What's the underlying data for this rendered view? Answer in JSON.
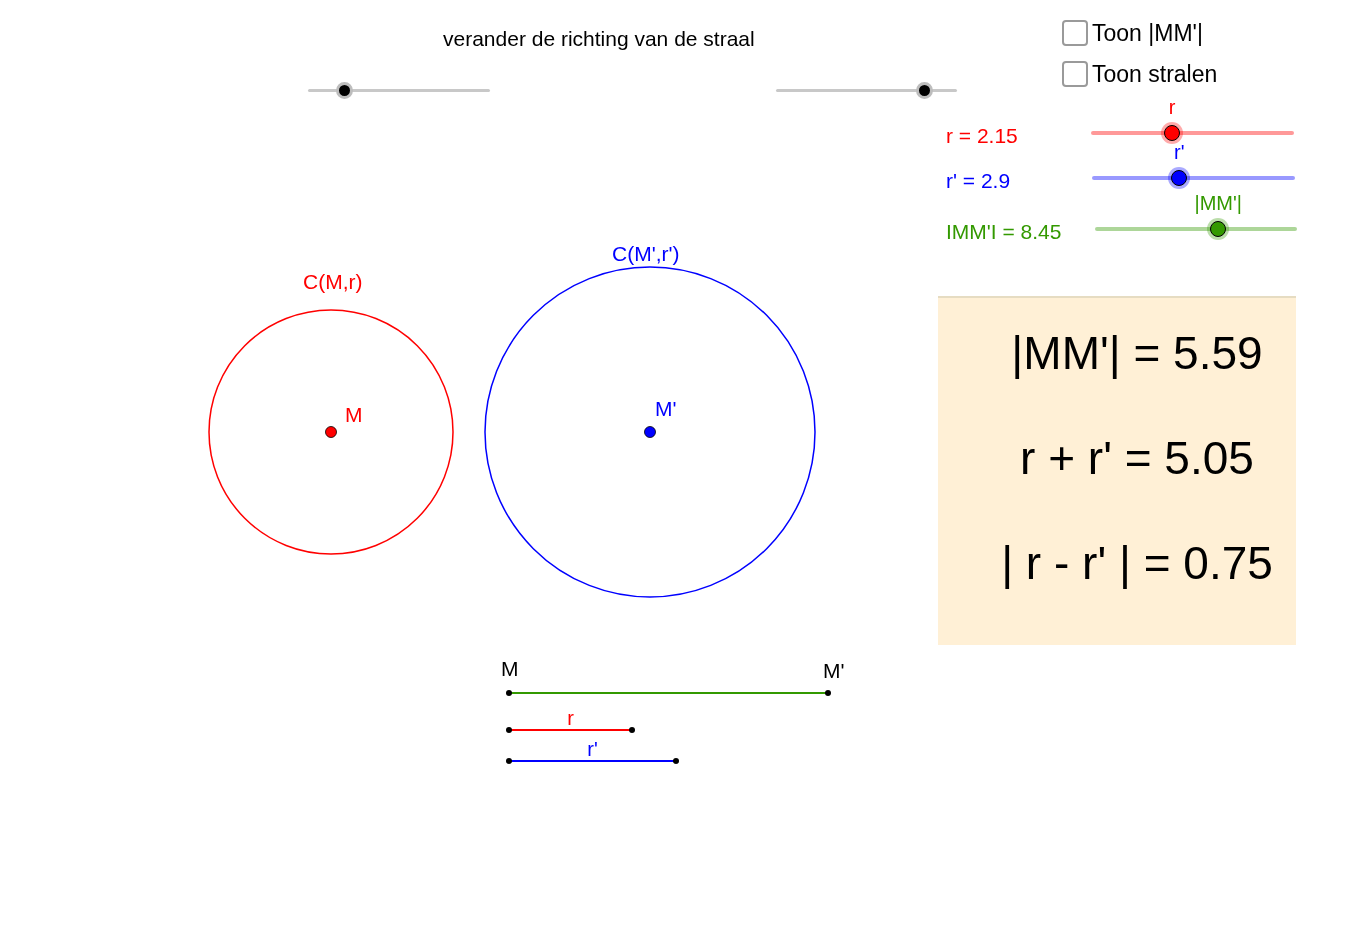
{
  "instruction": "verander de richting van de straal",
  "top_sliders": [
    {
      "level": 0.2
    },
    {
      "level": 0.82
    }
  ],
  "checkboxes": [
    {
      "label": "Toon |MM'|",
      "checked": false
    },
    {
      "label": "Toon stralen",
      "checked": false
    }
  ],
  "sliders": [
    {
      "reading": "r = 2.15",
      "thumb_label": "r",
      "color": "#ff0000",
      "level": 0.4
    },
    {
      "reading": "r' = 2.9",
      "thumb_label": "r'",
      "color": "#0000ff",
      "level": 0.43
    },
    {
      "reading": "IMM'I = 8.45",
      "thumb_label": "|MM'|",
      "color": "#339900",
      "level": 0.61
    }
  ],
  "circles": [
    {
      "label": "C(M,r)",
      "center_label": "M",
      "color": "#ff0000"
    },
    {
      "label": "C(M',r')",
      "center_label": "M'",
      "color": "#0000ff"
    }
  ],
  "result_panel": {
    "lines": [
      "|MM'| = 5.59",
      "r + r' = 5.05",
      "| r - r' | = 0.75"
    ]
  },
  "segments": [
    {
      "color": "#339900",
      "start_label": "M",
      "end_label": "M'"
    },
    {
      "color": "#ff0000",
      "label": "r"
    },
    {
      "color": "#0000ff",
      "label": "r'"
    }
  ]
}
